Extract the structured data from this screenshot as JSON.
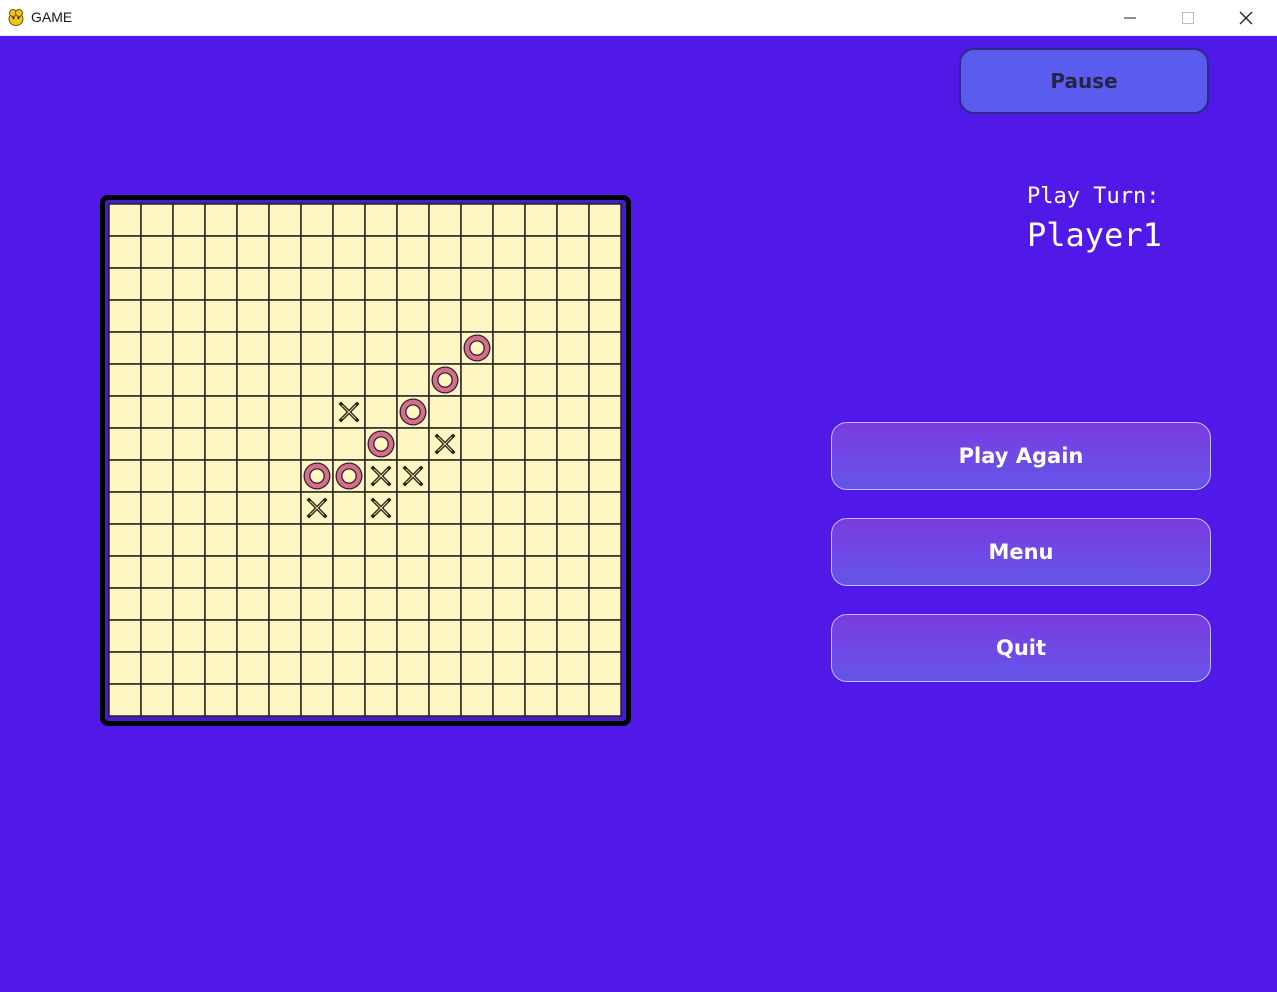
{
  "window": {
    "title": "GAME",
    "icon": "pygame-snake-icon",
    "controls": [
      "minimize-icon",
      "maximize-icon",
      "close-icon"
    ]
  },
  "game": {
    "pause_label": "Pause",
    "turn_label": "Play Turn:",
    "current_player": "Player1",
    "buttons": {
      "play_again": "Play Again",
      "menu": "Menu",
      "quit": "Quit"
    },
    "colors": {
      "background": "#5019e8",
      "cell": "#fff6c2",
      "grid": "#222222",
      "o_mark": "#d1708a",
      "x_mark": "#222222"
    },
    "board": {
      "rows": 16,
      "cols": 16,
      "marks": [
        {
          "row": 4,
          "col": 11,
          "mark": "O"
        },
        {
          "row": 5,
          "col": 10,
          "mark": "O"
        },
        {
          "row": 6,
          "col": 7,
          "mark": "X"
        },
        {
          "row": 6,
          "col": 9,
          "mark": "O"
        },
        {
          "row": 7,
          "col": 8,
          "mark": "O"
        },
        {
          "row": 7,
          "col": 10,
          "mark": "X"
        },
        {
          "row": 8,
          "col": 6,
          "mark": "O"
        },
        {
          "row": 8,
          "col": 7,
          "mark": "O"
        },
        {
          "row": 8,
          "col": 8,
          "mark": "X"
        },
        {
          "row": 8,
          "col": 9,
          "mark": "X"
        },
        {
          "row": 9,
          "col": 6,
          "mark": "X"
        },
        {
          "row": 9,
          "col": 8,
          "mark": "X"
        }
      ]
    }
  }
}
